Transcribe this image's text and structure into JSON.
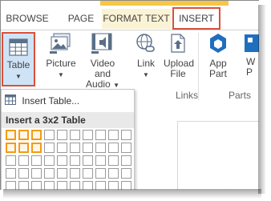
{
  "tabs": {
    "browse": "BROWSE",
    "page": "PAGE",
    "format_text": "FORMAT TEXT",
    "insert": "INSERT"
  },
  "ribbon": {
    "table": {
      "label": "Table",
      "icon": "table-icon"
    },
    "picture": {
      "label": "Picture",
      "icon": "picture-icon"
    },
    "video_audio": {
      "label_line1": "Video and",
      "label_line2": "Audio",
      "icon": "video-audio-icon"
    },
    "link": {
      "label": "Link",
      "icon": "link-icon"
    },
    "upload_file": {
      "label_line1": "Upload",
      "label_line2": "File",
      "icon": "upload-file-icon"
    },
    "app_part": {
      "label_line1": "App",
      "label_line2": "Part",
      "icon": "app-part-icon"
    },
    "web_part": {
      "label_line1": "W",
      "label_line2": "P",
      "icon": "web-part-icon"
    },
    "groups": {
      "links": "Links",
      "parts": "Parts"
    }
  },
  "menu": {
    "insert_table": "Insert Table...",
    "grid_header": "Insert a 3x2 Table",
    "grid": {
      "visible_cols": 10,
      "visible_rows": 6,
      "selected_cols": 3,
      "selected_rows": 2
    }
  },
  "colors": {
    "highlight": "#d9513a",
    "selected_button": "#cfe3f6",
    "contextual_tab": "#f6c744",
    "grid_selection": "#f39c12"
  }
}
